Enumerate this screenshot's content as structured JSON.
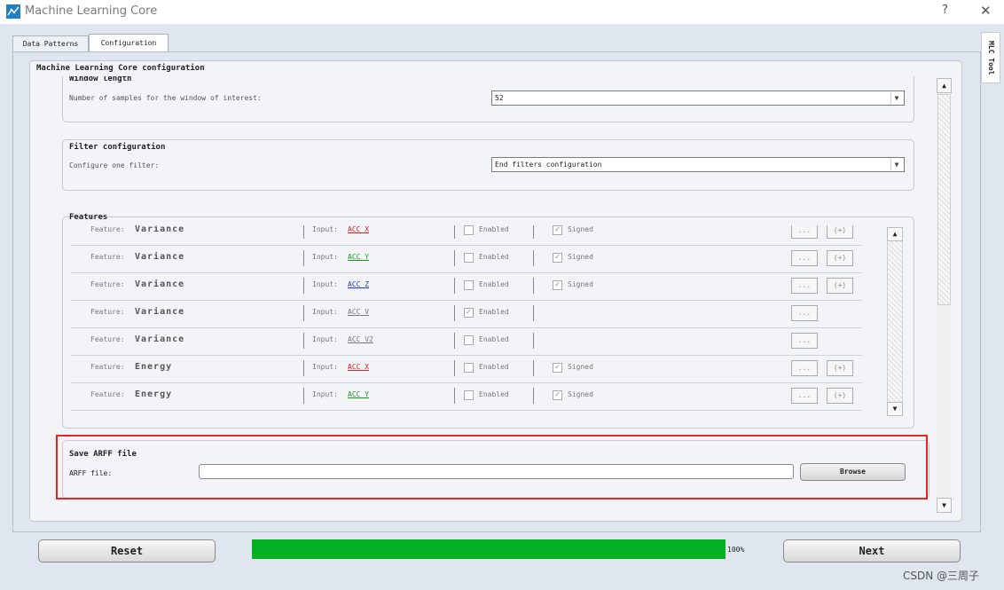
{
  "window": {
    "title": "Machine Learning Core",
    "help_glyph": "?",
    "close_glyph": "✕",
    "icon": "app-logo-icon"
  },
  "tabs": [
    {
      "label": "Data Patterns",
      "active": false
    },
    {
      "label": "Configuration",
      "active": true
    }
  ],
  "side_tab": {
    "label": "MLC Tool"
  },
  "mlc_group": {
    "title": "Machine Learning Core configuration"
  },
  "window_length": {
    "title": "Window length",
    "label": "Number of samples for the window of interest:",
    "value": "52"
  },
  "filter": {
    "title": "Filter configuration",
    "label": "Configure one filter:",
    "value": "End filters configuration"
  },
  "features": {
    "title": "Features",
    "feature_label": "Feature:",
    "input_label": "Input:",
    "enabled_label": "Enabled",
    "signed_label": "Signed",
    "dots_label": "...",
    "plus_label": "(+)",
    "rows": [
      {
        "name": "Variance",
        "input": "ACC_X",
        "input_color": "#d62020",
        "enabled": false,
        "signed": true,
        "has_signed": true
      },
      {
        "name": "Variance",
        "input": "ACC_Y",
        "input_color": "#1a9a1a",
        "enabled": false,
        "signed": true,
        "has_signed": true
      },
      {
        "name": "Variance",
        "input": "ACC_Z",
        "input_color": "#1a3bd6",
        "enabled": false,
        "signed": true,
        "has_signed": true
      },
      {
        "name": "Variance",
        "input": "ACC_V",
        "input_color": "#777777",
        "enabled": true,
        "signed": false,
        "has_signed": false
      },
      {
        "name": "Variance",
        "input": "ACC_V2",
        "input_color": "#777777",
        "enabled": false,
        "signed": false,
        "has_signed": false
      },
      {
        "name": "Energy",
        "input": "ACC_X",
        "input_color": "#d62020",
        "enabled": false,
        "signed": true,
        "has_signed": true
      },
      {
        "name": "Energy",
        "input": "ACC_Y",
        "input_color": "#1a9a1a",
        "enabled": false,
        "signed": true,
        "has_signed": true
      },
      {
        "name": "",
        "input": "",
        "input_color": "#777777",
        "enabled": false,
        "signed": false,
        "has_signed": true
      }
    ]
  },
  "arff": {
    "title": "Save ARFF file",
    "label": "ARFF file:",
    "value": "",
    "browse_label": "Browse"
  },
  "footer": {
    "reset_label": "Reset",
    "next_label": "Next",
    "progress_percent": 100,
    "progress_text": "100%",
    "progress_color": "#06b025"
  },
  "watermark": "CSDN @三周子",
  "colors": {
    "highlight": "#e8261f"
  }
}
